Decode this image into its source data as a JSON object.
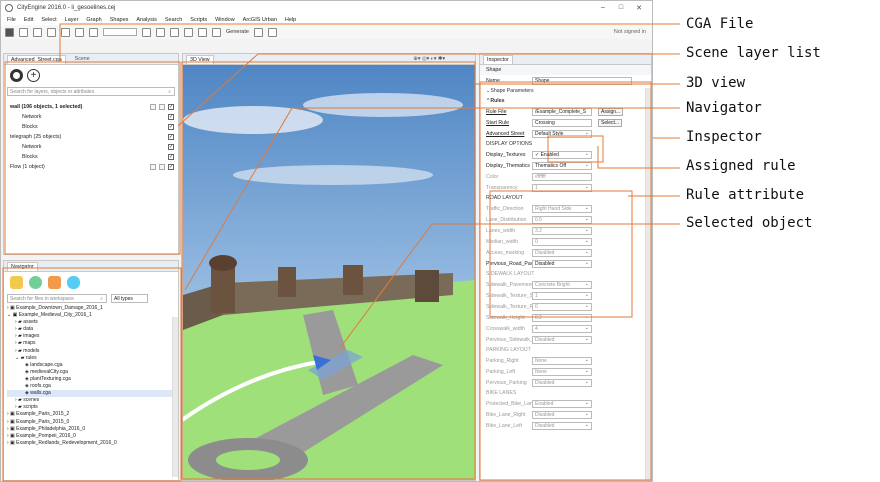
{
  "app": {
    "title": "CityEngine 2016.0 - li_gesoelines.cej"
  },
  "menu": [
    "File",
    "Edit",
    "Select",
    "Layer",
    "Graph",
    "Shapes",
    "Analysis",
    "Search",
    "Scripts",
    "Window",
    "ArcGIS Urban",
    "Help"
  ],
  "toolbar": {
    "generate_label": "Generate",
    "signed_in": "Not signed in"
  },
  "scene_panel": {
    "tabs": [
      "Advanced_Street.cga",
      "Scene"
    ],
    "search_placeholder": "Search for layers, objects or attributes",
    "layers": [
      {
        "label": "wall (106 objects, 1 selected)",
        "sub": [
          "Network",
          "Blocks"
        ]
      },
      {
        "label": "telegraph (25 objects)",
        "sub": [
          "Network",
          "Blocks"
        ]
      },
      {
        "label": "Flow (1 object)",
        "sub": []
      }
    ]
  },
  "viewport": {
    "tab": "3D View"
  },
  "navigator": {
    "tab": "Navigator",
    "search_placeholder": "Search for files in workspace",
    "filter": "All types",
    "tree": [
      "Example_Downtown_Damage_2016_1",
      "Example_Medieval_City_2016_1",
      "assets",
      "data",
      "images",
      "maps",
      "models",
      "rules",
      "landscape.cga",
      "medievalCity.cga",
      "plantTexturing.cga",
      "roofs.cga",
      "walls.cga",
      "scenes",
      "scripts",
      "Example_Paris_2015_2",
      "Example_Paris_2015_0",
      "Example_Philadelphia_2016_0",
      "Example_Pompeii_2016_0",
      "Example_Redlands_Redevelopment_2016_0"
    ]
  },
  "inspector": {
    "tab": "Inspector",
    "subtab": "Shape",
    "name_label": "Name",
    "name_value": "Shape",
    "shape_params": "Shape Parameters",
    "rules_label": "Rules",
    "rule_file_label": "Rule File",
    "rule_file_value": "/Example_Complete_S",
    "start_rule_label": "Start Rule",
    "start_rule_value": "Crossing",
    "assign_btn": "Assign...",
    "select_btn": "Select...",
    "style_label": "Advanced Street",
    "style_value": "Default Style",
    "display_options": "DISPLAY OPTIONS",
    "attrs": [
      [
        "Display_Textures",
        "✓ Enabled"
      ],
      [
        "Display_Thematics",
        "Thematics Off"
      ],
      [
        "Color",
        "#ffffff"
      ],
      [
        "Transparency",
        "1"
      ]
    ],
    "road_layout": "ROAD LAYOUT",
    "road_attrs": [
      [
        "Traffic_Direction",
        "Right Hand Side"
      ],
      [
        "Lane_Distribution",
        "0.5"
      ],
      [
        "Lanes_width",
        "3.2"
      ],
      [
        "Median_width",
        "0"
      ],
      [
        "Access_marking",
        "Disabled"
      ],
      [
        "Pervious_Road_Pavement",
        "Disabled"
      ]
    ],
    "sidewalk": "SIDEWALK LAYOUT",
    "side_attrs": [
      [
        "Sidewalk_Pavement",
        "Concrete Bright"
      ],
      [
        "Sidewalk_Texture_Scale",
        "1"
      ],
      [
        "Sidewalk_Texture_Rotation",
        "0"
      ],
      [
        "Sidewalk_Height",
        "0.2"
      ],
      [
        "Crosswalk_width",
        "4"
      ],
      [
        "Pervious_Sidewalk_Cover",
        "Disabled"
      ]
    ],
    "parking": "PARKING LAYOUT",
    "park_attrs": [
      [
        "Parking_Right",
        "None"
      ],
      [
        "Parking_Left",
        "None"
      ],
      [
        "Pervious_Parking",
        "Disabled"
      ]
    ],
    "bike": "BIKE LANES",
    "bike_attrs": [
      [
        "Protected_Bike_Lanes",
        "Enabled"
      ],
      [
        "Bike_Lane_Right",
        "Disabled"
      ],
      [
        "Bike_Lane_Left",
        "Disabled"
      ]
    ]
  },
  "annotations": [
    "CGA File",
    "Scene layer list",
    "3D view",
    "Navigator",
    "Inspector",
    "Assigned rule",
    "Rule attribute",
    "Selected object"
  ],
  "colors": {
    "callout": "#e07a3a",
    "sky": "#5b8fc7",
    "grass": "#9fe07a",
    "street": "#9a9a9a",
    "arrow": "#3a6fd8"
  }
}
